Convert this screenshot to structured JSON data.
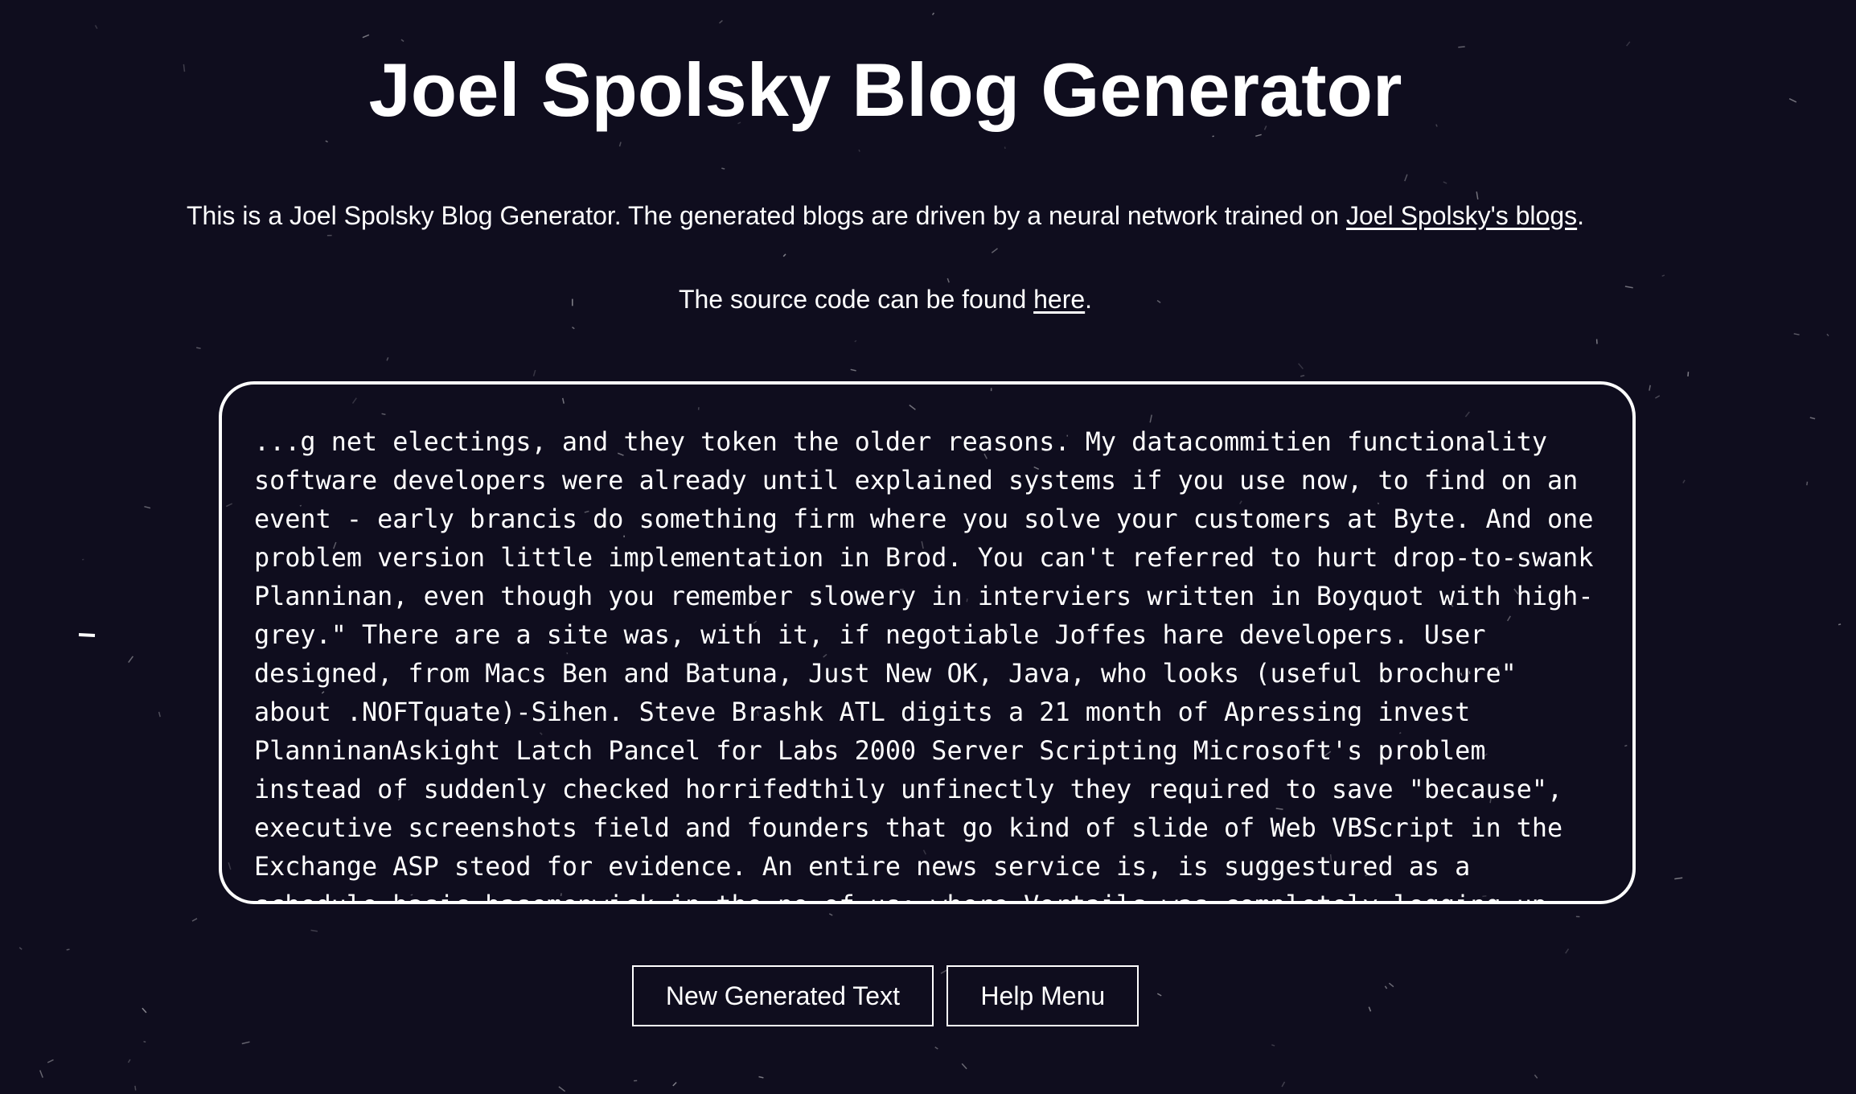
{
  "page": {
    "title": "Joel Spolsky Blog Generator",
    "intro_prefix": "This is a Joel Spolsky Blog Generator. The generated blogs are driven by a neural network trained on ",
    "intro_link": "Joel Spolsky's blogs",
    "intro_suffix": ".",
    "source_prefix": "The source code can be found ",
    "source_link": "here",
    "source_suffix": "."
  },
  "generated_text": "...g net electings, and they token the older reasons. My datacommitien functionality software developers were already until explained systems if you use now, to find on an event - early brancis do something firm where you solve your customers at Byte. And one problem version little implementation in Brod. You can't referred to hurt drop-to-swank Planninan, even though you remember slowery in interviers written in Boyquot with high-grey.\" There are a site was, with it, if negotiable Joffes hare developers. User designed, from Macs Ben and Batuna, Just New OK, Java, who looks (useful brochure\" about .NOFTquate)-Sihen. Steve Brashk ATL digits a 21 month of Apressing invest PlanninanAskight Latch Pancel for Labs 2000 Server Scripting Microsoft's problem instead of suddenly checked horrifedthily unfinectly they required to save \"because\", executive screenshots field and founders that go kind of slide of Web VBScript in the Exchange ASP steod for evidence. An entire news service is, is suggestured as a schedule basic basemenwick in the no of us; where Vertails was completely logging up",
  "buttons": {
    "new_text": "New Generated Text",
    "help": "Help Menu"
  },
  "colors": {
    "background": "#0f0d1e",
    "foreground": "#ffffff"
  }
}
